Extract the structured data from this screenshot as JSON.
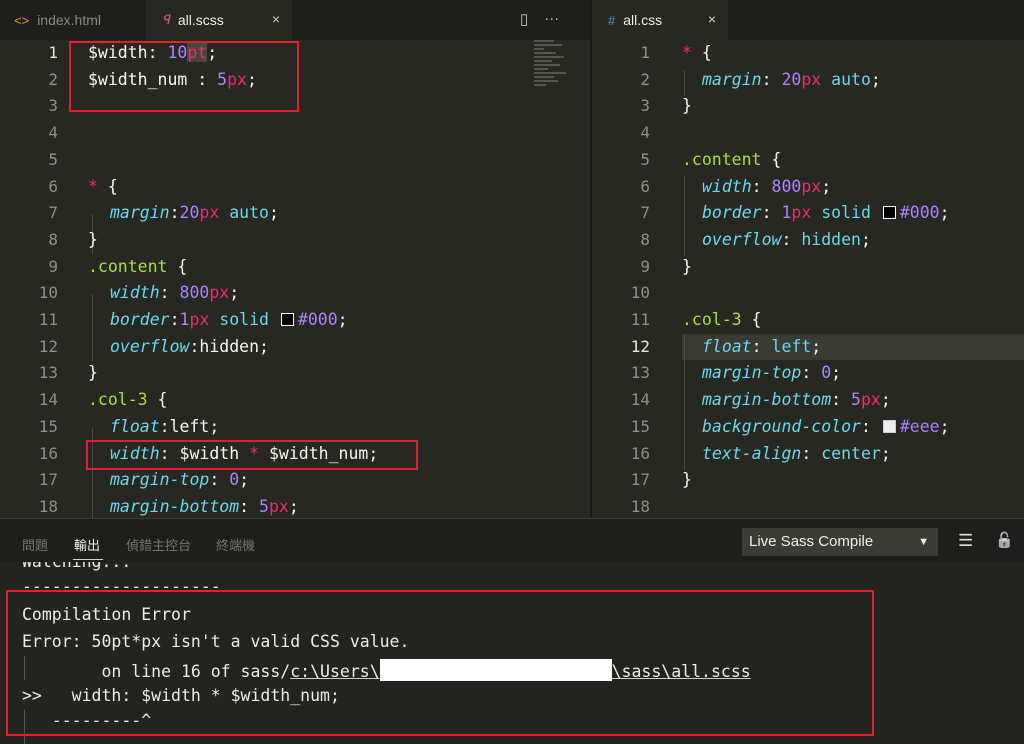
{
  "tabs_left": [
    {
      "label": "index.html",
      "icon": "html-icon",
      "active": false
    },
    {
      "label": "all.scss",
      "icon": "scss-icon",
      "active": true
    }
  ],
  "tabs_right": [
    {
      "label": "all.css",
      "icon": "css-icon",
      "active": true
    }
  ],
  "icons": {
    "close": "×",
    "split": "▯",
    "more": "···",
    "html": "<>",
    "scss": "ꟼ",
    "css": "#"
  },
  "left_editor": {
    "line_numbers": [
      "1",
      "2",
      "3",
      "4",
      "5",
      "6",
      "7",
      "8",
      "9",
      "10",
      "11",
      "12",
      "13",
      "14",
      "15",
      "16",
      "17",
      "18"
    ],
    "current_line": "1"
  },
  "right_editor": {
    "line_numbers": [
      "1",
      "2",
      "3",
      "4",
      "5",
      "6",
      "7",
      "8",
      "9",
      "10",
      "11",
      "12",
      "13",
      "14",
      "15",
      "16",
      "17",
      "18"
    ],
    "current_line": "12"
  },
  "scss_tokens": {
    "l1_var": "$width",
    "l1_colon": ": ",
    "l1_num": "10",
    "l1_unit": "pt",
    "l1_semi": ";",
    "l2_var": "$width_num",
    "l2_colon": " : ",
    "l2_num": "5",
    "l2_unit": "px",
    "l2_semi": ";",
    "l6_sel": "*",
    "l6_brace": " {",
    "l7_prop": "margin",
    "l7_colon": ":",
    "l7_num": "20",
    "l7_unit": "px",
    "l7_auto": " auto",
    "l7_semi": ";",
    "l8": "}",
    "l9_sel": ".content",
    "l9_brace": " {",
    "l10_prop": "width",
    "l10_colon": ": ",
    "l10_num": "800",
    "l10_unit": "px",
    "l10_semi": ";",
    "l11_prop": "border",
    "l11_colon": ":",
    "l11_num": "1",
    "l11_unit": "px",
    "l11_solid": " solid ",
    "l11_color": "#000",
    "l11_semi": ";",
    "l12_prop": "overflow",
    "l12_colon": ":",
    "l12_val": "hidden",
    "l12_semi": ";",
    "l13": "}",
    "l14_sel": ".col-3",
    "l14_brace": " {",
    "l15_prop": "float",
    "l15_colon": ":",
    "l15_val": "left",
    "l15_semi": ";",
    "l16_prop": "width",
    "l16_colon": ": ",
    "l16_var1": "$width",
    "l16_op": " * ",
    "l16_var2": "$width_num",
    "l16_semi": ";",
    "l17_prop": "margin-top",
    "l17_colon": ": ",
    "l17_num": "0",
    "l17_semi": ";",
    "l18_prop": "margin-bottom",
    "l18_colon": ": ",
    "l18_num": "5",
    "l18_unit": "px",
    "l18_semi": ";"
  },
  "css_tokens": {
    "l1_sel": "*",
    "l1_brace": " {",
    "l2_prop": "margin",
    "l2_colon": ": ",
    "l2_num": "20",
    "l2_unit": "px",
    "l2_auto": " auto",
    "l2_semi": ";",
    "l3": "}",
    "l5_sel": ".content",
    "l5_brace": " {",
    "l6_prop": "width",
    "l6_colon": ": ",
    "l6_num": "800",
    "l6_unit": "px",
    "l6_semi": ";",
    "l7_prop": "border",
    "l7_colon": ": ",
    "l7_num": "1",
    "l7_unit": "px",
    "l7_solid": " solid ",
    "l7_color": "#000",
    "l7_semi": ";",
    "l8_prop": "overflow",
    "l8_colon": ": ",
    "l8_val": "hidden",
    "l8_semi": ";",
    "l9": "}",
    "l11_sel": ".col-3",
    "l11_brace": " {",
    "l12_prop": "float",
    "l12_colon": ": ",
    "l12_val": "left",
    "l12_semi": ";",
    "l13_prop": "margin-top",
    "l13_colon": ": ",
    "l13_num": "0",
    "l13_semi": ";",
    "l14_prop": "margin-bottom",
    "l14_colon": ": ",
    "l14_num": "5",
    "l14_unit": "px",
    "l14_semi": ";",
    "l15_prop": "background-color",
    "l15_colon": ": ",
    "l15_color": "#eee",
    "l15_semi": ";",
    "l16_prop": "text-align",
    "l16_colon": ": ",
    "l16_val": "center",
    "l16_semi": ";",
    "l17": "}"
  },
  "swatch_colors": {
    "black": "#000000",
    "light": "#eeeeee"
  },
  "panel": {
    "tabs": [
      "問題",
      "輸出",
      "偵錯主控台",
      "終端機"
    ],
    "active_tab": "輸出",
    "dropdown_value": "Live Sass Compile",
    "dropdown_arrow": "▼",
    "clear_icon": "☰",
    "lock_icon": "🔓"
  },
  "output": {
    "l0": "Watching...",
    "l1": "--------------------",
    "l2": "Compilation Error",
    "l3": "Error: 50pt*px isn't a valid CSS value.",
    "l4_prefix": "        on line 16 of sass/",
    "l4_path1": "c:\\Users\\",
    "l4_path2": "\\sass\\all.scss",
    "l5": ">>   width: $width * $width_num;",
    "l6": "   ---------^"
  }
}
